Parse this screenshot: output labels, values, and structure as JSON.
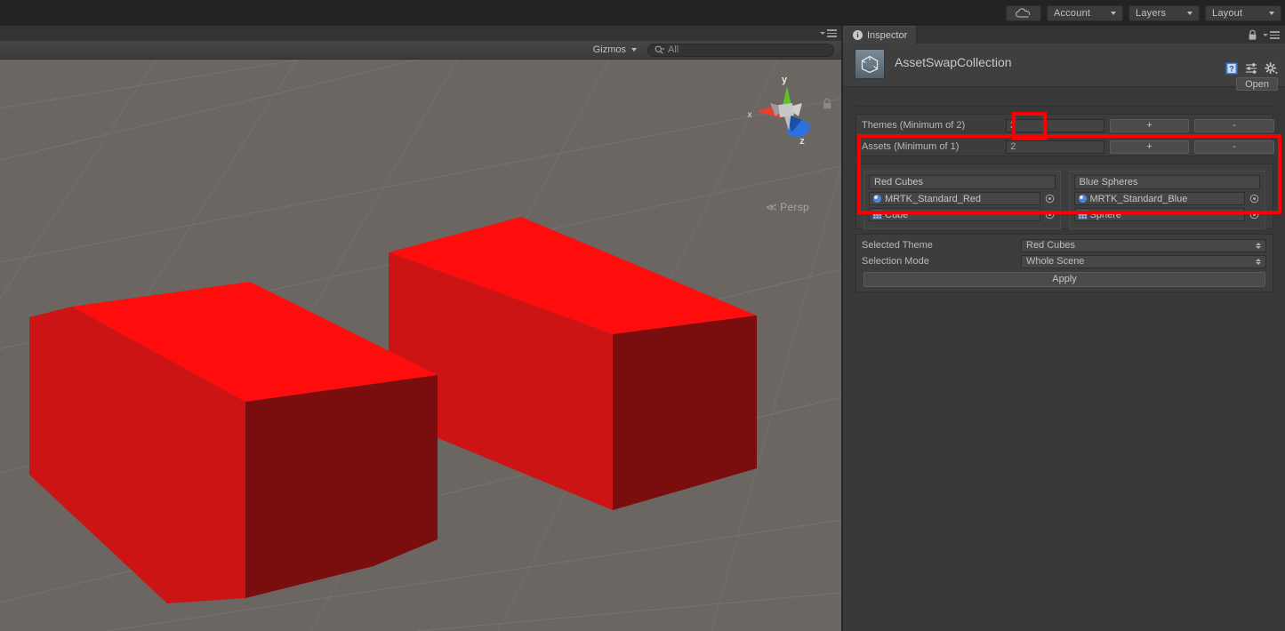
{
  "top_toolbar": {
    "cloud_icon": "cloud-icon",
    "buttons": [
      {
        "label": "Account",
        "icon": "chevron-down-icon"
      },
      {
        "label": "Layers",
        "icon": "chevron-down-icon"
      },
      {
        "label": "Layout",
        "icon": "chevron-down-icon"
      }
    ]
  },
  "scene": {
    "gizmos_label": "Gizmos",
    "search_placeholder": "All",
    "search_value": "",
    "search_icon": "search-icon",
    "perspective_label": "Persp",
    "lock_icon": "lock-icon",
    "panel_menu_icon": "panel-menu-icon",
    "axis_gizmo": {
      "x_label": "x",
      "y_label": "y",
      "z_label": "z",
      "x_color": "#e8402a",
      "y_color": "#5bc22d",
      "z_color": "#2b72e0"
    },
    "background_color": "#6b6662",
    "cube_colors": {
      "top": "#ff0d0d",
      "left": "#cc1414",
      "right": "#7a0e0e"
    }
  },
  "inspector": {
    "tab_label": "Inspector",
    "tab_icon": "info-icon",
    "lock_icon": "lock-icon",
    "menu_icon": "panel-menu-icon",
    "asset_icon": "unity-asset-icon",
    "asset_title": "AssetSwapCollection",
    "header_icons": [
      "help-book-icon",
      "preset-icon",
      "gear-icon"
    ],
    "open_label": "Open",
    "counts": [
      {
        "label": "Themes (Minimum of 2)",
        "value": "2",
        "add_label": "+",
        "remove_label": "-"
      },
      {
        "label": "Assets (Minimum of 1)",
        "value": "2",
        "add_label": "+",
        "remove_label": "-"
      }
    ],
    "themes": [
      {
        "name": "Red Cubes",
        "assets": [
          {
            "label": "MRTK_Standard_Red",
            "icon": "material-sphere-icon",
            "picker_icon": "object-picker-icon"
          },
          {
            "label": "Cube",
            "icon": "prefab-mesh-icon",
            "picker_icon": "object-picker-icon"
          }
        ]
      },
      {
        "name": "Blue Spheres",
        "assets": [
          {
            "label": "MRTK_Standard_Blue",
            "icon": "material-sphere-icon",
            "picker_icon": "object-picker-icon"
          },
          {
            "label": "Sphere",
            "icon": "prefab-mesh-icon",
            "picker_icon": "object-picker-icon"
          }
        ]
      }
    ],
    "settings": [
      {
        "label": "Selected Theme",
        "value": "Red Cubes"
      },
      {
        "label": "Selection Mode",
        "value": "Whole Scene"
      }
    ],
    "apply_label": "Apply"
  },
  "annotations": {
    "highlight_color": "#fb0000",
    "count_field_highlight": "assets-count-field",
    "themes_block_highlight": "themes-asset-list"
  }
}
